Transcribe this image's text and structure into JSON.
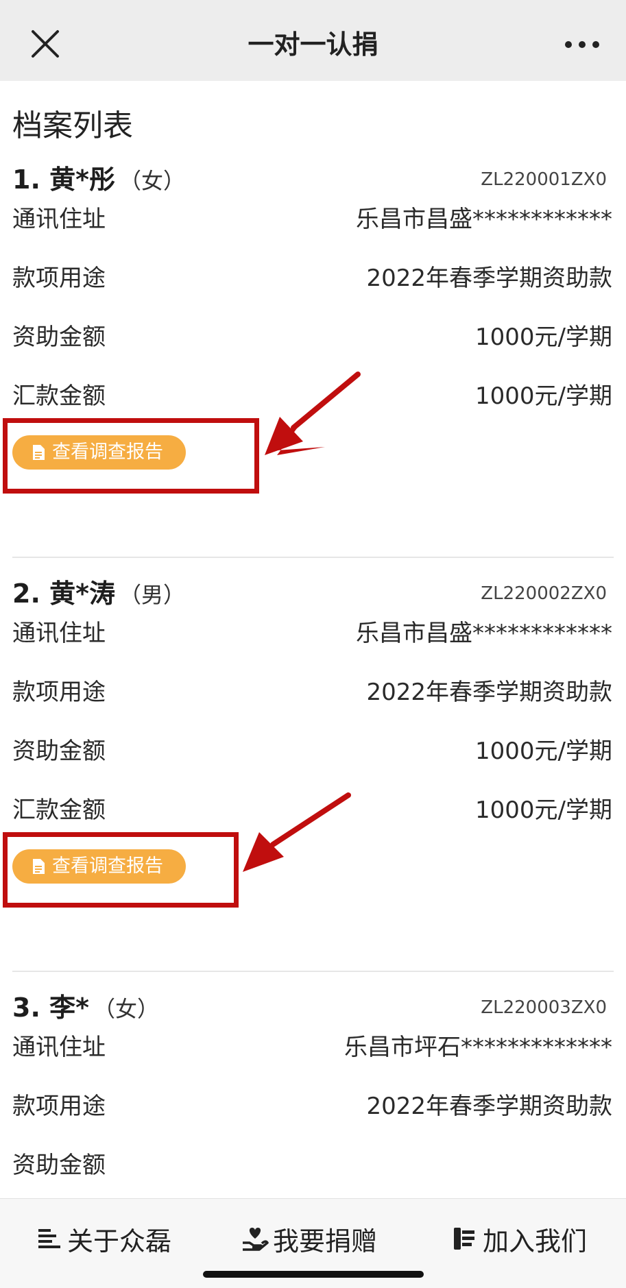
{
  "navbar": {
    "title": "一对一认捐",
    "close_icon": "close-icon",
    "more_icon": "more-icon"
  },
  "page": {
    "heading": "档案列表"
  },
  "labels": {
    "address": "通讯住址",
    "purpose": "款项用途",
    "aid_amount": "资助金额",
    "remit_amount": "汇款金额"
  },
  "records": [
    {
      "index_name": "1. 黄*彤",
      "gender": "（女）",
      "code": "ZL220001ZX0",
      "address": "乐昌市昌盛************",
      "purpose": "2022年春季学期资助款",
      "aid_amount": "1000元/学期",
      "remit_amount": "1000元/学期",
      "report_button": "查看调查报告"
    },
    {
      "index_name": "2. 黄*涛",
      "gender": "（男）",
      "code": "ZL220002ZX0",
      "address": "乐昌市昌盛************",
      "purpose": "2022年春季学期资助款",
      "aid_amount": "1000元/学期",
      "remit_amount": "1000元/学期",
      "report_button": "查看调查报告"
    },
    {
      "index_name": "3. 李*",
      "gender": "（女）",
      "code": "ZL220003ZX0",
      "address": "乐昌市坪石*************",
      "purpose": "2022年春季学期资助款"
    }
  ],
  "tabbar": {
    "items": [
      {
        "label": "关于众磊",
        "icon": "list-icon"
      },
      {
        "label": "我要捐赠",
        "icon": "donate-hand-icon"
      },
      {
        "label": "加入我们",
        "icon": "join-icon"
      }
    ]
  },
  "colors": {
    "button": "#f6ad42",
    "annotation": "#c00e0e",
    "navbar": "#ededed"
  }
}
